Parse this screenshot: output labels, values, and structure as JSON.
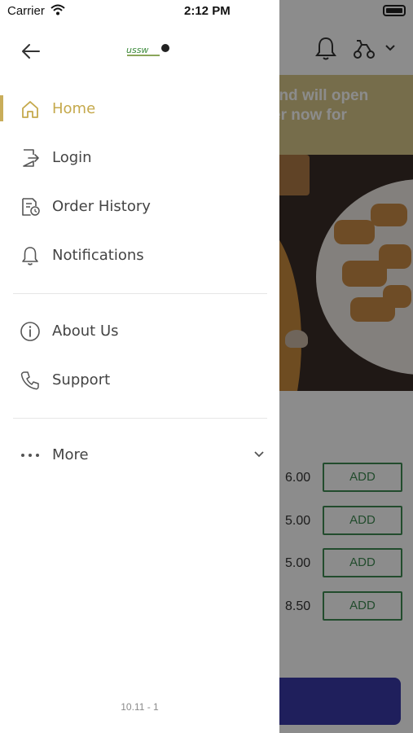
{
  "status_bar": {
    "carrier": "Carrier",
    "time": "2:12 PM"
  },
  "drawer": {
    "logo_text": "ussw",
    "menu": [
      {
        "label": "Home",
        "icon": "home-icon",
        "active": true
      },
      {
        "label": "Login",
        "icon": "login-icon",
        "active": false
      },
      {
        "label": "Order History",
        "icon": "order-history-icon",
        "active": false
      },
      {
        "label": "Notifications",
        "icon": "bell-icon",
        "active": false
      }
    ],
    "menu_secondary": [
      {
        "label": "About Us",
        "icon": "info-icon"
      },
      {
        "label": "Support",
        "icon": "phone-icon"
      }
    ],
    "more_label": "More",
    "version": "10.11 - 1",
    "accent_color": "#c5a94c"
  },
  "background": {
    "banner_lines": [
      "d and will open",
      "rder now for"
    ],
    "banner_color": "#d8c789",
    "items": [
      {
        "price": "6.00",
        "add_label": "ADD"
      },
      {
        "price": "5.00",
        "add_label": "ADD"
      },
      {
        "price": "5.00",
        "add_label": "ADD"
      },
      {
        "price": "8.50",
        "add_label": "ADD"
      }
    ],
    "add_color": "#3f8a52",
    "cart_color": "#3a3aa8"
  }
}
